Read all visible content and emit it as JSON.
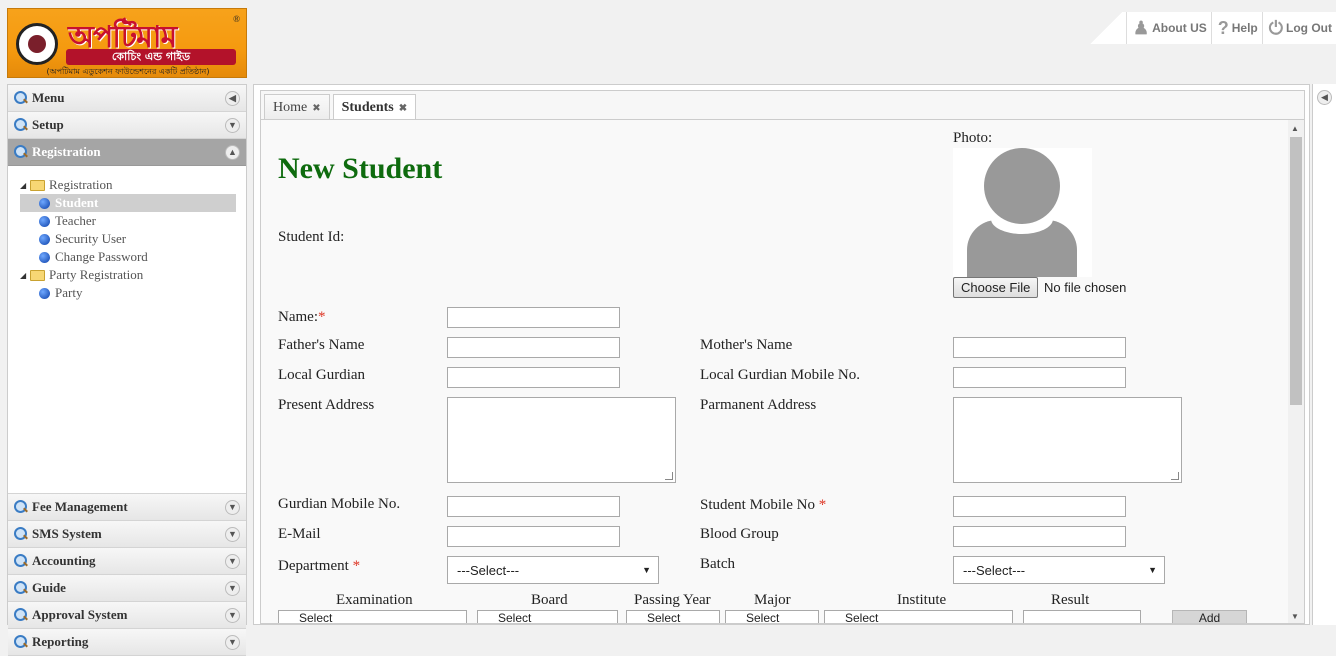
{
  "logo": {
    "title": "অপটিমাম",
    "bar": "কোচিং এন্ড গাইড",
    "sub": "(অপটিমাম এডুকেশন ফাউন্ডেশনের একটি প্রতিষ্ঠান)",
    "reg": "®"
  },
  "topnav": {
    "about": "About US",
    "help": "Help",
    "logout": "Log Out"
  },
  "sidebar": {
    "sections_top": [
      "Menu",
      "Setup"
    ],
    "active": "Registration",
    "tree": {
      "group1": "Registration",
      "items1": [
        "Student",
        "Teacher",
        "Security User",
        "Change Password"
      ],
      "group2": "Party Registration",
      "items2": [
        "Party"
      ]
    },
    "sections_bottom": [
      "Fee Management",
      "SMS System",
      "Accounting",
      "Guide",
      "Approval System",
      "Reporting"
    ]
  },
  "tabs": [
    "Home",
    "Students"
  ],
  "form": {
    "title": "New Student",
    "student_id": "Student Id:",
    "photo": "Photo:",
    "choose_file": "Choose File",
    "no_file": "No file chosen",
    "name": "Name:",
    "father": "Father's Name",
    "mother": "Mother's Name",
    "local_guardian": "Local Gurdian",
    "local_guardian_mobile": "Local Gurdian Mobile No.",
    "present_address": "Present Address",
    "permanent_address": "Parmanent Address",
    "guardian_mobile": "Gurdian Mobile No.",
    "student_mobile": "Student Mobile No",
    "email": "E-Mail",
    "blood_group": "Blood Group",
    "department": "Department",
    "batch": "Batch",
    "select_placeholder": "---Select---",
    "required_mark": "*"
  },
  "exam_grid": {
    "headers": [
      "Examination",
      "Board",
      "Passing Year",
      "Major",
      "Institute",
      "Result"
    ],
    "select_text": "Select",
    "add_label": "Add"
  }
}
